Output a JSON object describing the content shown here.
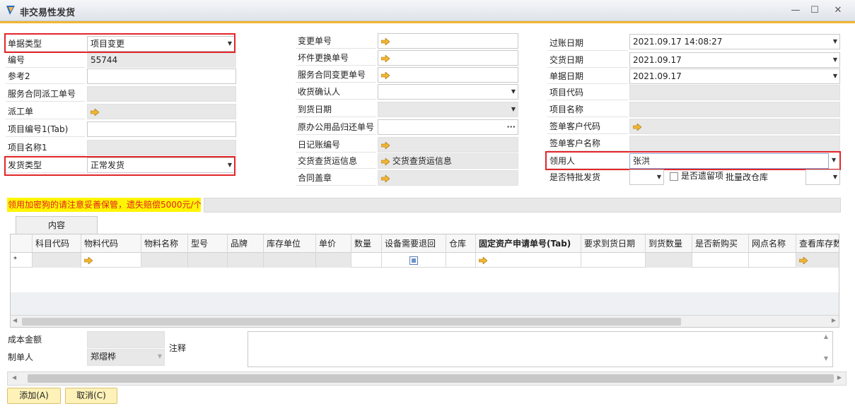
{
  "window": {
    "title": "非交易性发货",
    "minimize": "—",
    "maximize": "☐",
    "close": "✕"
  },
  "left": {
    "doc_type": {
      "label": "单据类型",
      "value": "项目变更"
    },
    "number": {
      "label": "编号",
      "value": "55744"
    },
    "ref2": {
      "label": "参考2",
      "value": ""
    },
    "svc_dispatch": {
      "label": "服务合同派工单号",
      "value": ""
    },
    "dispatch": {
      "label": "派工单",
      "value": ""
    },
    "project_code1": {
      "label": "项目编号1(Tab)",
      "value": ""
    },
    "project_name1": {
      "label": "项目名称1",
      "value": ""
    },
    "ship_type": {
      "label": "发货类型",
      "value": "正常发货"
    }
  },
  "middle": {
    "change_no": {
      "label": "变更单号",
      "value": ""
    },
    "broken_replace": {
      "label": "坏件更换单号",
      "value": ""
    },
    "svc_change": {
      "label": "服务合同变更单号",
      "value": ""
    },
    "receipt_confirm": {
      "label": "收货确认人",
      "value": ""
    },
    "arrival_date": {
      "label": "到货日期",
      "value": ""
    },
    "office_return": {
      "label": "原办公用品归还单号",
      "value": ""
    },
    "journal_no": {
      "label": "日记账编号",
      "value": ""
    },
    "ship_check": {
      "label": "交货查货运信息",
      "value": "交货查货运信息"
    },
    "contract_seal": {
      "label": "合同盖章",
      "value": ""
    },
    "ellipsis": "···"
  },
  "right": {
    "posting_date": {
      "label": "过账日期",
      "value": "2021.09.17 14:08:27"
    },
    "delivery_date": {
      "label": "交货日期",
      "value": "2021.09.17"
    },
    "doc_date": {
      "label": "单据日期",
      "value": "2021.09.17"
    },
    "project_code": {
      "label": "项目代码",
      "value": ""
    },
    "project_name": {
      "label": "项目名称",
      "value": ""
    },
    "sign_cust_code": {
      "label": "签单客户代码",
      "value": ""
    },
    "sign_cust_name": {
      "label": "签单客户名称",
      "value": ""
    },
    "recipient": {
      "label": "领用人",
      "value": "张洪"
    },
    "special_batch": {
      "label": "是否特批发货",
      "value": ""
    },
    "leftover": {
      "label": "是否遗留项"
    },
    "batch_wh": {
      "label": "批量改仓库",
      "value": ""
    }
  },
  "warning": "领用加密狗的请注意妥善保管，遗失赔偿5000元/个",
  "tab_content": "内容",
  "grid": {
    "row_marker": "*",
    "columns": [
      "科目代码",
      "物料代码",
      "物料名称",
      "型号",
      "品牌",
      "库存单位",
      "单价",
      "数量",
      "设备需要退回",
      "仓库",
      "固定资产申请单号(Tab)",
      "要求到货日期",
      "到货数量",
      "是否新购买",
      "网点名称",
      "查看库存数"
    ]
  },
  "footer": {
    "cost": {
      "label": "成本金额",
      "value": ""
    },
    "maker": {
      "label": "制单人",
      "value": "郑熠桦"
    },
    "remark": {
      "label": "注释",
      "value": ""
    }
  },
  "buttons": {
    "add": "添加(A)",
    "cancel": "取消(C)"
  },
  "colors": {
    "accent": "#f2b632",
    "highlight": "#e2262a",
    "warning_bg": "#fff500",
    "warning_text": "#e02020",
    "button_bg": "#fff2b8"
  }
}
